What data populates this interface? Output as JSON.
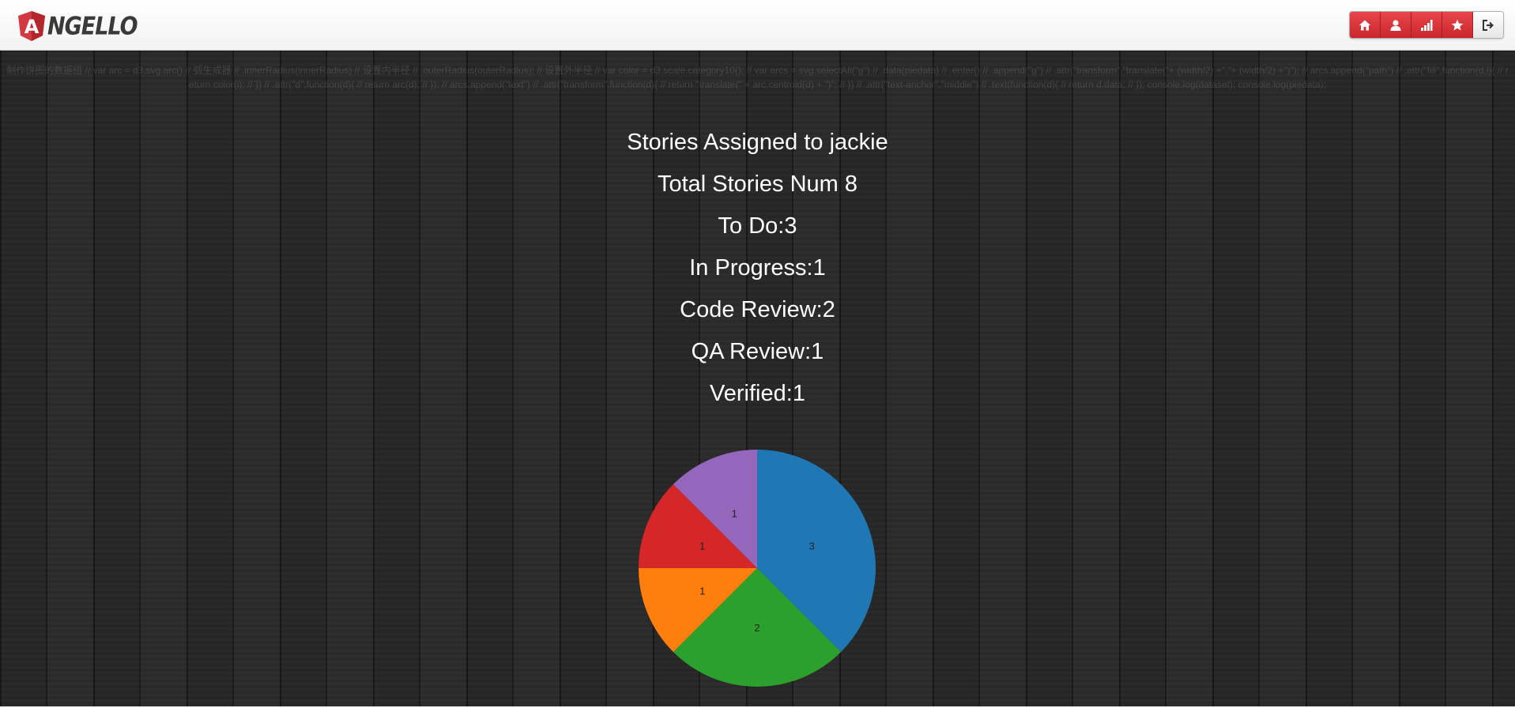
{
  "header": {
    "brand_text": "NGELLO",
    "brand_logo_letter": "A",
    "brand_color": "#d33a3f",
    "buttons": [
      {
        "name": "home-button",
        "icon": "home-icon"
      },
      {
        "name": "user-button",
        "icon": "user-icon"
      },
      {
        "name": "stats-button",
        "icon": "signal-bars-icon"
      },
      {
        "name": "favorites-button",
        "icon": "star-icon"
      },
      {
        "name": "logout-button",
        "icon": "logout-icon"
      }
    ]
  },
  "code_comment": "制作饼图的数据组 // var arc = d3.svg.arc() // 弧生成器 // .innerRadius(innerRadius) // 设置内半径 // .outerRadius(outerRadius); // 设置外半径 // var color = d3.scale.category10(); // var arcs = svg.selectAll(\"g\") // .data(piedata) // .enter() // .append(\"g\") // .attr(\"transform\",\"translate(\"+ (width/2) +\",\"+ (width/2) +\")\"); // arcs.append(\"path\") // .attr(\"fill\",function(d,i){ // return color(i); // }) // .attr(\"d\",function(d){ // return arc(d); // }); // arcs.append(\"text\") // .attr(\"transform\",function(d){ // return \"translate(\" + arc.centroid(d) + \")\"; // }) // .attr(\"text-anchor\",\"middle\") // .text(function(d){ // return d.data; // }); console.log(dataset); console.log(piedata);",
  "stats": {
    "title": "Stories Assigned to jackie",
    "total": "Total Stories Num 8",
    "todo": "To Do:3",
    "in_progress": "In Progress:1",
    "code_review": "Code Review:2",
    "qa_review": "QA Review:1",
    "verified": "Verified:1"
  },
  "chart_data": {
    "type": "pie",
    "categories": [
      "To Do",
      "Code Review",
      "QA Review",
      "In Progress",
      "Verified"
    ],
    "values": [
      3,
      2,
      1,
      1,
      1
    ],
    "labels": [
      "3",
      "2",
      "1",
      "1",
      "1"
    ],
    "colors": [
      "#1f77b4",
      "#2ca02c",
      "#ff7f0e",
      "#d62728",
      "#9467bd"
    ],
    "start": "12 o'clock, clockwise",
    "label_color": "#222222"
  }
}
